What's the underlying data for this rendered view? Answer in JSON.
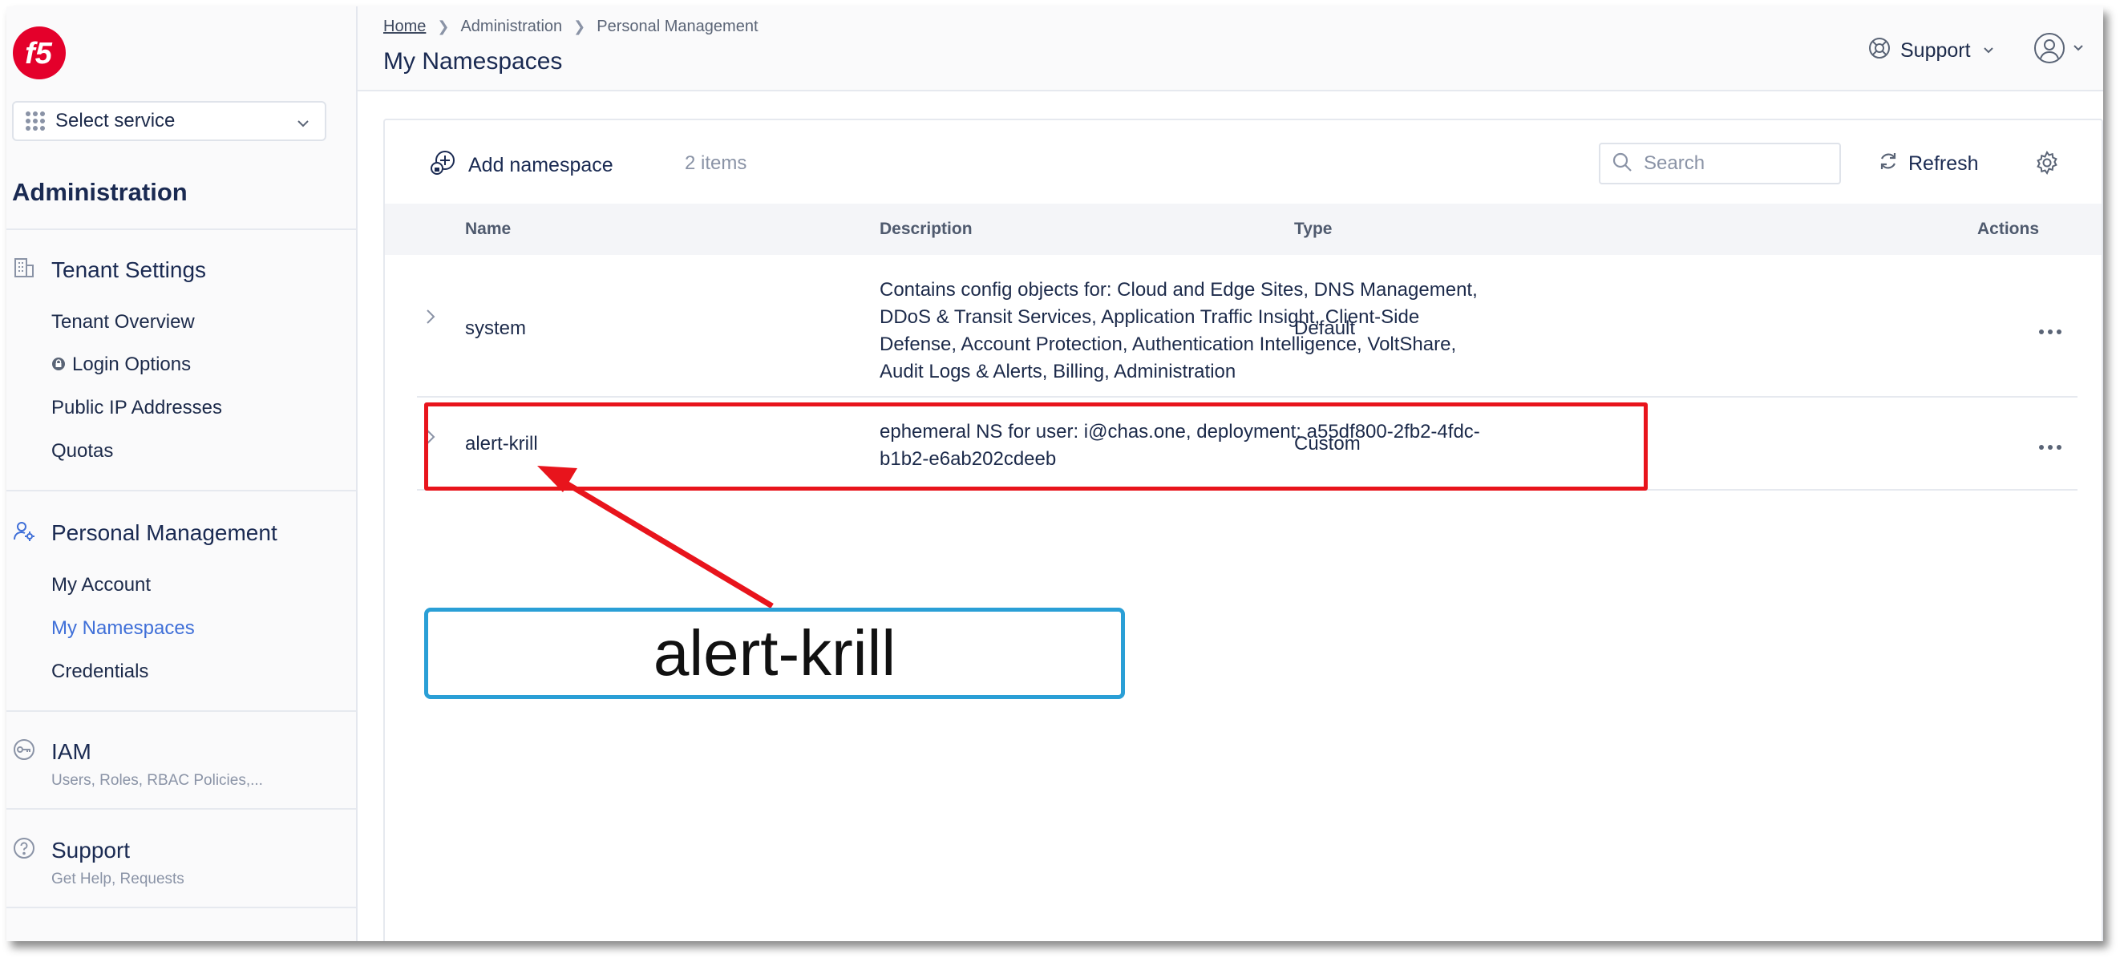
{
  "sidebar": {
    "select_service": "Select service",
    "section_title": "Administration",
    "groups": [
      {
        "title": "Tenant Settings",
        "icon": "building-icon",
        "items": [
          "Tenant Overview",
          "Login Options",
          "Public IP Addresses",
          "Quotas"
        ]
      },
      {
        "title": "Personal Management",
        "icon": "user-settings-icon",
        "items": [
          "My Account",
          "My Namespaces",
          "Credentials"
        ],
        "active_item": "My Namespaces"
      },
      {
        "title": "IAM",
        "icon": "key-icon",
        "subtitle": "Users, Roles, RBAC Policies,..."
      },
      {
        "title": "Support",
        "icon": "help-icon",
        "subtitle": "Get Help, Requests"
      }
    ]
  },
  "header": {
    "breadcrumb": [
      "Home",
      "Administration",
      "Personal Management"
    ],
    "title": "My Namespaces",
    "support_label": "Support"
  },
  "toolbar": {
    "add_label": "Add namespace",
    "item_count": "2 items",
    "search_placeholder": "Search",
    "refresh_label": "Refresh"
  },
  "table": {
    "columns": [
      "Name",
      "Description",
      "Type",
      "Actions"
    ],
    "rows": [
      {
        "name": "system",
        "description_lines": [
          "Contains config objects for: Cloud and Edge Sites, DNS Management,",
          "DDoS & Transit Services, Application Traffic Insight, Client-Side",
          "Defense, Account Protection, Authentication Intelligence, VoltShare,",
          "Audit Logs & Alerts, Billing, Administration"
        ],
        "type": "Default"
      },
      {
        "name": "alert-krill",
        "description_lines": [
          "ephemeral NS for user: i@chas.one, deployment: a55df800-2fb2-4fdc-",
          "b1b2-e6ab202cdeeb"
        ],
        "type": "Custom"
      }
    ]
  },
  "annotation": {
    "callout_text": "alert-krill",
    "highlight_color": "#e8141c",
    "callout_border_color": "#2a9fd6"
  },
  "colors": {
    "accent": "#3f6fd8",
    "brand": "#e4002b",
    "text": "#1c2a4a"
  }
}
